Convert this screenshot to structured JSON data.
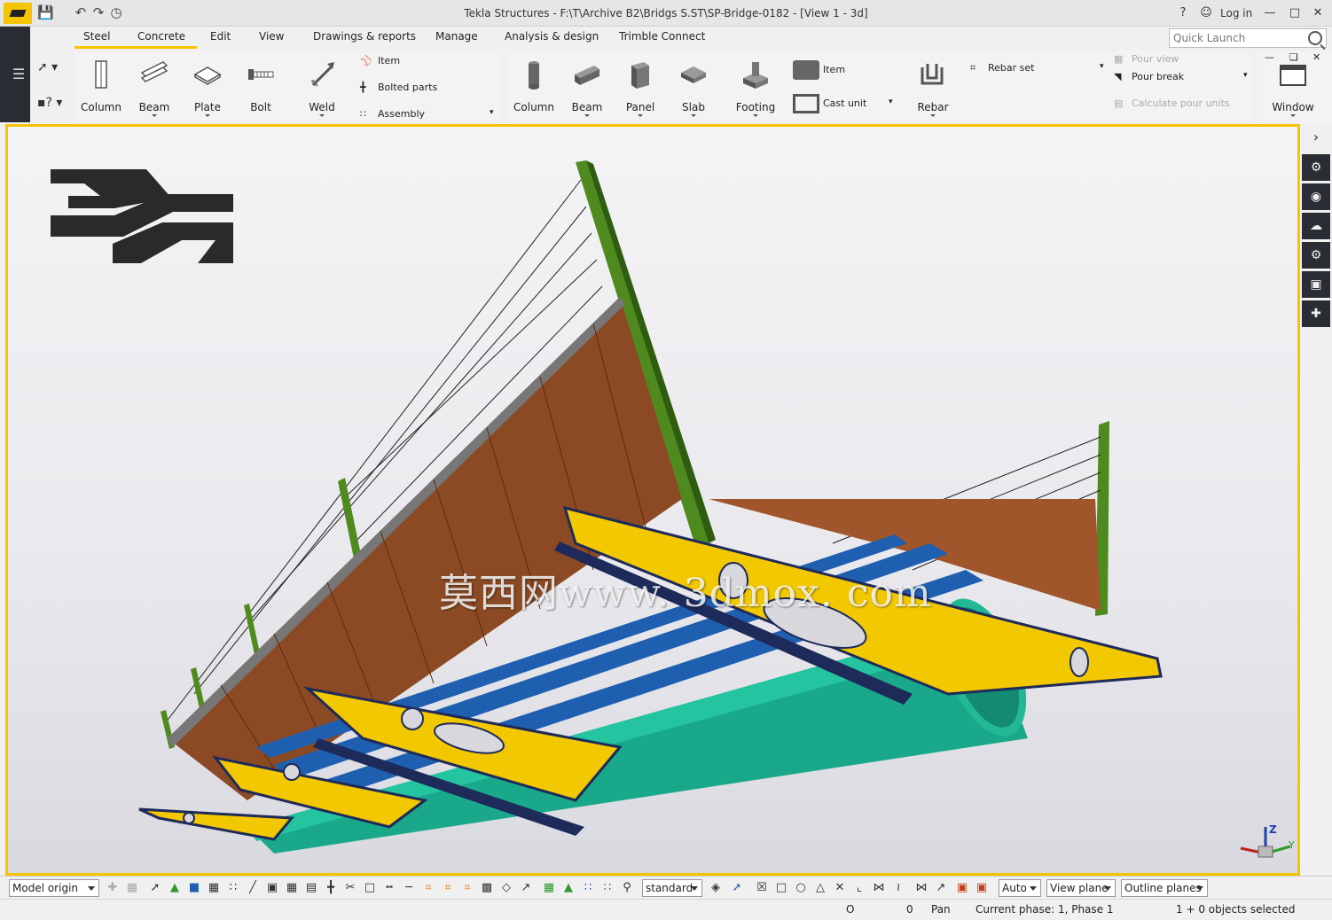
{
  "window": {
    "title": "Tekla Structures - F:\\T\\Archive B2\\Bridgs S.ST\\SP-Bridge-0182  - [View 1 - 3d]",
    "help": "?",
    "login": "Log in"
  },
  "tabs": [
    "Steel",
    "Concrete",
    "Edit",
    "View",
    "Drawings & reports",
    "Manage",
    "Analysis & design",
    "Trimble Connect"
  ],
  "active_tab": "Concrete",
  "quick_launch": {
    "placeholder": "Quick Launch"
  },
  "ribbon": {
    "steel_big": [
      "Column",
      "Beam",
      "Plate",
      "Bolt",
      "Weld"
    ],
    "steel_small": [
      "Item",
      "Bolted parts",
      "Assembly"
    ],
    "concrete_big": [
      "Column",
      "Beam",
      "Panel",
      "Slab",
      "Footing"
    ],
    "concrete_small": [
      "Item",
      "Cast unit"
    ],
    "rebar": "Rebar",
    "rebar_set": "Rebar set",
    "pour": [
      "Pour view",
      "Pour break",
      "Calculate pour units"
    ],
    "window": "Window"
  },
  "viewport": {
    "watermark": "莫西网www. 3dmox. com",
    "axis_z": "Z",
    "axis_y": "Y"
  },
  "bottom_toolbar": {
    "origin": "Model origin",
    "snap_setting": "standard",
    "auto": "Auto",
    "plane": "View plane",
    "planes_mode": "Outline planes"
  },
  "status": {
    "coord_o": "O",
    "coord_0": "0",
    "mode": "Pan",
    "phase": "Current phase: 1, Phase 1",
    "selection": "1 + 0 objects selected"
  },
  "colors": {
    "accent": "#f5c400",
    "sidebar": "#2a2d33",
    "girder_yellow": "#f2c800",
    "deck_brown": "#8b4a24",
    "pylon_green": "#4e8a1e",
    "pipe_teal": "#1aa88a",
    "beam_blue": "#1f5fb0",
    "frame_navy": "#1e2a5a"
  }
}
